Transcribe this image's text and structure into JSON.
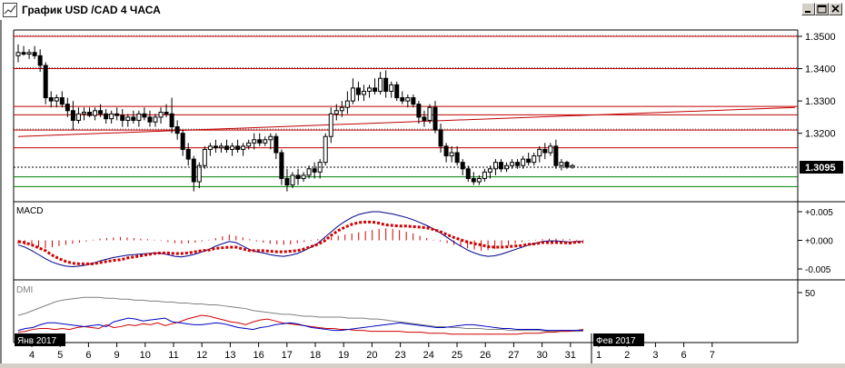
{
  "window": {
    "title": "График USD /CAD  4 ЧАСА",
    "buttons": [
      "minimize",
      "restore",
      "close"
    ]
  },
  "main_chart": {
    "price_labels": [
      "1.3500",
      "1.3400",
      "1.3300",
      "1.3200",
      "1.3095"
    ],
    "price_values": [
      1.35,
      1.34,
      1.33,
      1.32,
      1.3095
    ],
    "current_price": "1.3095",
    "hlines": [
      {
        "price": 1.35,
        "color": "#c00000"
      },
      {
        "price": 1.34,
        "color": "#c00000"
      },
      {
        "price": 1.3283,
        "color": "#c00000"
      },
      {
        "price": 1.3257,
        "color": "#c00000"
      },
      {
        "price": 1.321,
        "color": "#c00000"
      },
      {
        "price": 1.3155,
        "color": "#c00000"
      },
      {
        "price": 1.3065,
        "color": "#008000"
      },
      {
        "price": 1.3035,
        "color": "#008000"
      }
    ],
    "trendline": {
      "from_day": 0,
      "from_price": 1.319,
      "to_day": 27.4,
      "to_price": 1.328,
      "color": "#c00000"
    },
    "candles": [
      [
        1.344,
        1.3475,
        1.342,
        1.345
      ],
      [
        1.345,
        1.347,
        1.344,
        1.3445
      ],
      [
        1.3445,
        1.346,
        1.343,
        1.345
      ],
      [
        1.345,
        1.347,
        1.343,
        1.344
      ],
      [
        1.344,
        1.346,
        1.339,
        1.341
      ],
      [
        1.341,
        1.342,
        1.329,
        1.331
      ],
      [
        1.331,
        1.333,
        1.328,
        1.33
      ],
      [
        1.33,
        1.332,
        1.328,
        1.331
      ],
      [
        1.331,
        1.333,
        1.328,
        1.329
      ],
      [
        1.329,
        1.331,
        1.325,
        1.327
      ],
      [
        1.327,
        1.33,
        1.321,
        1.324
      ],
      [
        1.324,
        1.328,
        1.323,
        1.326
      ],
      [
        1.326,
        1.328,
        1.324,
        1.3265
      ],
      [
        1.3265,
        1.328,
        1.325,
        1.3255
      ],
      [
        1.3255,
        1.328,
        1.324,
        1.327
      ],
      [
        1.327,
        1.329,
        1.325,
        1.326
      ],
      [
        1.326,
        1.3275,
        1.323,
        1.3245
      ],
      [
        1.3245,
        1.327,
        1.323,
        1.326
      ],
      [
        1.326,
        1.328,
        1.324,
        1.3255
      ],
      [
        1.3255,
        1.3275,
        1.322,
        1.324
      ],
      [
        1.324,
        1.326,
        1.322,
        1.325
      ],
      [
        1.325,
        1.327,
        1.323,
        1.324
      ],
      [
        1.324,
        1.327,
        1.322,
        1.326
      ],
      [
        1.326,
        1.328,
        1.324,
        1.325
      ],
      [
        1.325,
        1.327,
        1.322,
        1.3235
      ],
      [
        1.3235,
        1.326,
        1.322,
        1.325
      ],
      [
        1.325,
        1.328,
        1.323,
        1.3265
      ],
      [
        1.3265,
        1.329,
        1.325,
        1.326
      ],
      [
        1.326,
        1.331,
        1.32,
        1.322
      ],
      [
        1.322,
        1.324,
        1.318,
        1.32
      ],
      [
        1.32,
        1.321,
        1.313,
        1.315
      ],
      [
        1.315,
        1.317,
        1.31,
        1.312
      ],
      [
        1.312,
        1.313,
        1.302,
        1.305
      ],
      [
        1.305,
        1.311,
        1.303,
        1.31
      ],
      [
        1.31,
        1.316,
        1.309,
        1.315
      ],
      [
        1.315,
        1.317,
        1.313,
        1.316
      ],
      [
        1.316,
        1.318,
        1.314,
        1.3155
      ],
      [
        1.3155,
        1.317,
        1.314,
        1.316
      ],
      [
        1.316,
        1.318,
        1.314,
        1.315
      ],
      [
        1.315,
        1.317,
        1.313,
        1.316
      ],
      [
        1.316,
        1.318,
        1.314,
        1.315
      ],
      [
        1.315,
        1.317,
        1.313,
        1.316
      ],
      [
        1.316,
        1.318,
        1.315,
        1.317
      ],
      [
        1.317,
        1.32,
        1.315,
        1.318
      ],
      [
        1.318,
        1.32,
        1.316,
        1.317
      ],
      [
        1.317,
        1.319,
        1.316,
        1.318
      ],
      [
        1.318,
        1.32,
        1.315,
        1.319
      ],
      [
        1.319,
        1.32,
        1.312,
        1.314
      ],
      [
        1.314,
        1.315,
        1.304,
        1.306
      ],
      [
        1.306,
        1.309,
        1.302,
        1.304
      ],
      [
        1.304,
        1.308,
        1.303,
        1.307
      ],
      [
        1.307,
        1.309,
        1.304,
        1.306
      ],
      [
        1.306,
        1.308,
        1.305,
        1.307
      ],
      [
        1.307,
        1.31,
        1.306,
        1.309
      ],
      [
        1.309,
        1.311,
        1.306,
        1.308
      ],
      [
        1.308,
        1.312,
        1.306,
        1.311
      ],
      [
        1.311,
        1.32,
        1.31,
        1.319
      ],
      [
        1.319,
        1.328,
        1.317,
        1.326
      ],
      [
        1.326,
        1.329,
        1.324,
        1.327
      ],
      [
        1.327,
        1.33,
        1.325,
        1.328
      ],
      [
        1.328,
        1.333,
        1.326,
        1.33
      ],
      [
        1.33,
        1.337,
        1.329,
        1.334
      ],
      [
        1.334,
        1.336,
        1.33,
        1.332
      ],
      [
        1.332,
        1.335,
        1.33,
        1.333
      ],
      [
        1.333,
        1.335,
        1.331,
        1.334
      ],
      [
        1.334,
        1.337,
        1.332,
        1.333
      ],
      [
        1.333,
        1.339,
        1.332,
        1.337
      ],
      [
        1.337,
        1.3395,
        1.331,
        1.333
      ],
      [
        1.333,
        1.336,
        1.331,
        1.335
      ],
      [
        1.335,
        1.336,
        1.33,
        1.331
      ],
      [
        1.331,
        1.333,
        1.329,
        1.33
      ],
      [
        1.33,
        1.332,
        1.328,
        1.331
      ],
      [
        1.331,
        1.332,
        1.328,
        1.329
      ],
      [
        1.329,
        1.33,
        1.323,
        1.325
      ],
      [
        1.325,
        1.327,
        1.322,
        1.324
      ],
      [
        1.324,
        1.329,
        1.323,
        1.328
      ],
      [
        1.328,
        1.33,
        1.32,
        1.321
      ],
      [
        1.321,
        1.323,
        1.314,
        1.316
      ],
      [
        1.316,
        1.317,
        1.311,
        1.313
      ],
      [
        1.313,
        1.316,
        1.311,
        1.314
      ],
      [
        1.314,
        1.316,
        1.31,
        1.311
      ],
      [
        1.311,
        1.312,
        1.307,
        1.309
      ],
      [
        1.309,
        1.31,
        1.305,
        1.306
      ],
      [
        1.306,
        1.308,
        1.304,
        1.305
      ],
      [
        1.305,
        1.307,
        1.304,
        1.306
      ],
      [
        1.306,
        1.309,
        1.305,
        1.308
      ],
      [
        1.308,
        1.31,
        1.306,
        1.309
      ],
      [
        1.309,
        1.312,
        1.307,
        1.311
      ],
      [
        1.311,
        1.312,
        1.308,
        1.309
      ],
      [
        1.309,
        1.311,
        1.308,
        1.31
      ],
      [
        1.31,
        1.312,
        1.309,
        1.311
      ],
      [
        1.311,
        1.312,
        1.309,
        1.31
      ],
      [
        1.31,
        1.313,
        1.309,
        1.312
      ],
      [
        1.312,
        1.314,
        1.31,
        1.311
      ],
      [
        1.311,
        1.314,
        1.31,
        1.313
      ],
      [
        1.313,
        1.316,
        1.311,
        1.315
      ],
      [
        1.315,
        1.317,
        1.312,
        1.314
      ],
      [
        1.314,
        1.317,
        1.313,
        1.316
      ],
      [
        1.316,
        1.318,
        1.309,
        1.31
      ],
      [
        1.31,
        1.312,
        1.3085,
        1.311
      ],
      [
        1.311,
        1.3115,
        1.309,
        1.3095
      ],
      [
        1.3095,
        1.3105,
        1.309,
        1.31
      ]
    ]
  },
  "macd": {
    "label": "MACD",
    "axis_labels": [
      "+0.005",
      "+0.000",
      "-0.005"
    ],
    "axis_values": [
      0.005,
      0.0,
      -0.005
    ],
    "histogram": [
      -0.0006,
      -0.0008,
      -0.001,
      -0.0012,
      -0.0014,
      -0.0012,
      -0.001,
      -0.0008,
      -0.0006,
      -0.0004,
      -0.0002,
      0.0001,
      0.0003,
      0.0004,
      0.0005,
      0.0006,
      0.0005,
      0.0004,
      0.0003,
      0.0002,
      0.0001,
      -0.0001,
      -0.0003,
      -0.0005,
      -0.0006,
      -0.0005,
      -0.0004,
      -0.0002,
      0.0001,
      0.0004,
      0.0007,
      0.001,
      0.0008,
      0.0005,
      0.0002,
      -0.0002,
      -0.0004,
      -0.0006,
      -0.0007,
      -0.0008,
      -0.0007,
      -0.0005,
      -0.0003,
      -0.0001,
      0.0002,
      0.0004,
      0.0006,
      0.0008,
      0.001,
      0.0012,
      0.0014,
      0.0016,
      0.0018,
      0.002,
      0.0021,
      0.002,
      0.0018,
      0.0015,
      0.0012,
      0.0008,
      0.0004,
      0.0001,
      -0.0002,
      -0.0005,
      -0.0008,
      -0.0011,
      -0.0014,
      -0.0016,
      -0.0018,
      -0.0017,
      -0.0015,
      -0.0012,
      -0.0009,
      -0.0006,
      -0.0003,
      -0.0001,
      0.0001,
      0.0002,
      0.0003,
      0.0003,
      0.0002,
      0.0002,
      0.0001,
      0.0001
    ],
    "macd_line": [
      -0.0008,
      -0.0012,
      -0.0018,
      -0.0025,
      -0.0032,
      -0.0038,
      -0.0042,
      -0.0045,
      -0.0046,
      -0.0045,
      -0.0043,
      -0.004,
      -0.0036,
      -0.0033,
      -0.003,
      -0.0028,
      -0.0026,
      -0.0025,
      -0.0024,
      -0.0023,
      -0.0022,
      -0.0023,
      -0.0025,
      -0.0028,
      -0.0029,
      -0.0027,
      -0.0024,
      -0.002,
      -0.0016,
      -0.001,
      -0.0006,
      -0.0002,
      -0.0004,
      -0.001,
      -0.0016,
      -0.002,
      -0.0022,
      -0.0025,
      -0.0027,
      -0.0028,
      -0.0026,
      -0.0023,
      -0.0018,
      -0.0012,
      -0.0005,
      0.0005,
      0.0015,
      0.0025,
      0.0033,
      0.004,
      0.0045,
      0.0048,
      0.005,
      0.005,
      0.0048,
      0.0046,
      0.0043,
      0.004,
      0.0036,
      0.0031,
      0.0026,
      0.002,
      0.0013,
      0.0005,
      -0.0003,
      -0.001,
      -0.0017,
      -0.0022,
      -0.0026,
      -0.0028,
      -0.0027,
      -0.0024,
      -0.002,
      -0.0016,
      -0.0012,
      -0.0008,
      -0.0005,
      -0.0002,
      -0.0001,
      -0.0001,
      -0.0002,
      -0.0003,
      -0.0002,
      -0.0002
    ],
    "signal_line": [
      -0.0002,
      -0.0004,
      -0.0008,
      -0.0013,
      -0.0018,
      -0.0026,
      -0.0032,
      -0.0037,
      -0.004,
      -0.0041,
      -0.0041,
      -0.0041,
      -0.0039,
      -0.0037,
      -0.0035,
      -0.0034,
      -0.0031,
      -0.0029,
      -0.0027,
      -0.0025,
      -0.0023,
      -0.0022,
      -0.0022,
      -0.0023,
      -0.0023,
      -0.0022,
      -0.002,
      -0.0018,
      -0.0017,
      -0.0014,
      -0.0013,
      -0.0012,
      -0.0012,
      -0.0015,
      -0.0018,
      -0.0018,
      -0.0018,
      -0.0019,
      -0.002,
      -0.002,
      -0.0019,
      -0.0018,
      -0.0015,
      -0.0011,
      -0.0007,
      -0.0001,
      0.0009,
      0.0017,
      0.0023,
      0.0028,
      0.0031,
      0.0032,
      0.0032,
      0.003,
      0.0027,
      0.0026,
      0.0025,
      0.0025,
      0.0024,
      0.0023,
      0.0022,
      0.0019,
      0.0015,
      0.001,
      0.0005,
      0.0001,
      -0.0003,
      -0.0006,
      -0.0008,
      -0.0011,
      -0.0012,
      -0.0012,
      -0.0011,
      -0.001,
      -0.0009,
      -0.0007,
      -0.0006,
      -0.0004,
      -0.0004,
      -0.0004,
      -0.0004,
      -0.0005,
      -0.0003,
      -0.0003
    ]
  },
  "dmi": {
    "label": "DMI",
    "axis_labels": [
      "50"
    ],
    "axis_values": [
      50
    ],
    "adx": [
      26,
      28,
      31,
      34,
      37,
      40,
      42,
      43,
      44,
      45,
      45,
      45,
      44,
      44,
      43,
      43,
      42,
      42,
      41,
      41,
      40,
      40,
      39,
      39,
      38,
      38,
      37,
      37,
      36,
      35,
      34,
      33,
      31,
      30,
      29,
      28,
      27,
      27,
      26,
      25,
      25,
      24,
      24,
      24,
      24,
      23,
      23,
      23,
      22,
      22,
      21,
      20,
      19,
      18,
      17,
      16,
      15,
      14,
      14,
      13,
      13,
      12,
      12,
      12,
      11,
      11,
      11,
      10,
      10,
      10,
      10,
      10,
      9,
      9,
      9,
      9,
      9,
      9
    ],
    "plus_di": [
      8,
      9,
      11,
      12,
      12,
      11,
      12,
      11,
      13,
      14,
      13,
      12,
      16,
      13,
      14,
      16,
      15,
      17,
      16,
      18,
      15,
      17,
      19,
      22,
      24,
      26,
      25,
      23,
      21,
      19,
      18,
      16,
      19,
      21,
      22,
      20,
      18,
      17,
      16,
      15,
      14,
      13,
      12,
      12,
      11,
      11,
      10,
      10,
      9,
      9,
      9,
      9,
      9,
      8,
      8,
      8,
      7,
      7,
      7,
      6,
      6,
      6,
      6,
      6,
      6,
      6,
      6,
      6,
      6,
      7,
      7,
      7,
      8,
      8,
      9,
      9,
      10,
      11
    ],
    "minus_di": [
      10,
      12,
      13,
      16,
      18,
      18,
      17,
      16,
      15,
      14,
      15,
      16,
      14,
      19,
      21,
      23,
      22,
      20,
      21,
      22,
      23,
      19,
      18,
      17,
      16,
      16,
      17,
      18,
      17,
      15,
      13,
      12,
      11,
      13,
      14,
      16,
      17,
      18,
      17,
      15,
      13,
      12,
      11,
      10,
      10,
      11,
      12,
      13,
      14,
      15,
      16,
      17,
      18,
      17,
      16,
      15,
      14,
      13,
      13,
      14,
      15,
      16,
      16,
      15,
      14,
      13,
      12,
      12,
      11,
      11,
      11,
      11,
      10,
      10,
      10,
      10,
      10,
      10
    ]
  },
  "x_axis": {
    "month_labels": [
      {
        "text": "Янв 2017",
        "day": 0
      },
      {
        "text": "Фев 2017",
        "day": 20
      }
    ],
    "day_labels": [
      "4",
      "5",
      "6",
      "9",
      "10",
      "11",
      "12",
      "13",
      "16",
      "17",
      "18",
      "19",
      "20",
      "23",
      "24",
      "25",
      "26",
      "27",
      "30",
      "31",
      "1",
      "2",
      "3",
      "6",
      "7"
    ],
    "future_start_day": 20
  },
  "colors": {
    "resistance": "#c00000",
    "support": "#008000",
    "macd_line": "#00008b",
    "signal_line": "#d00000",
    "histogram": "#d00000",
    "adx": "#808080",
    "plus_di": "#d00000",
    "minus_di": "#0000c0",
    "current_price_bg": "#000000"
  }
}
